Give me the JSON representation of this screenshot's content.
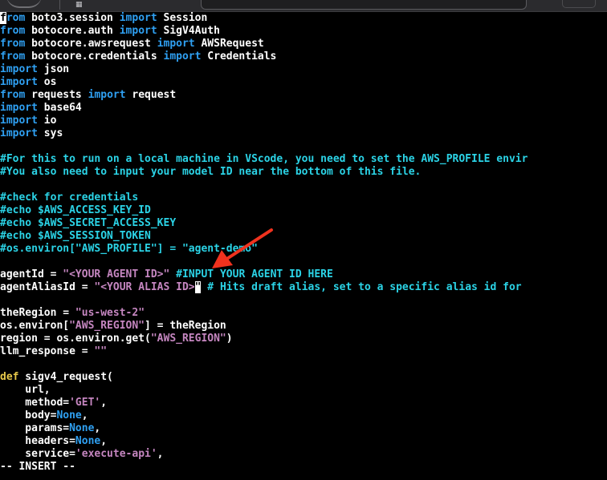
{
  "editor": {
    "mode_line": "-- INSERT --",
    "lines": [
      {
        "segs": [
          {
            "t": "f",
            "c": "cur"
          },
          {
            "t": "rom",
            "c": "kw"
          },
          {
            "t": " boto3.session ",
            "c": ""
          },
          {
            "t": "import",
            "c": "kw"
          },
          {
            "t": " Session",
            "c": ""
          }
        ]
      },
      {
        "segs": [
          {
            "t": "from",
            "c": "kw"
          },
          {
            "t": " botocore.auth ",
            "c": ""
          },
          {
            "t": "import",
            "c": "kw"
          },
          {
            "t": " SigV4Auth",
            "c": ""
          }
        ]
      },
      {
        "segs": [
          {
            "t": "from",
            "c": "kw"
          },
          {
            "t": " botocore.awsrequest ",
            "c": ""
          },
          {
            "t": "import",
            "c": "kw"
          },
          {
            "t": " AWSRequest",
            "c": ""
          }
        ]
      },
      {
        "segs": [
          {
            "t": "from",
            "c": "kw"
          },
          {
            "t": " botocore.credentials ",
            "c": ""
          },
          {
            "t": "import",
            "c": "kw"
          },
          {
            "t": " Credentials",
            "c": ""
          }
        ]
      },
      {
        "segs": [
          {
            "t": "import",
            "c": "kw"
          },
          {
            "t": " json",
            "c": ""
          }
        ]
      },
      {
        "segs": [
          {
            "t": "import",
            "c": "kw"
          },
          {
            "t": " os",
            "c": ""
          }
        ]
      },
      {
        "segs": [
          {
            "t": "from",
            "c": "kw"
          },
          {
            "t": " requests ",
            "c": ""
          },
          {
            "t": "import",
            "c": "kw"
          },
          {
            "t": " request",
            "c": ""
          }
        ]
      },
      {
        "segs": [
          {
            "t": "import",
            "c": "kw"
          },
          {
            "t": " base64",
            "c": ""
          }
        ]
      },
      {
        "segs": [
          {
            "t": "import",
            "c": "kw"
          },
          {
            "t": " io",
            "c": ""
          }
        ]
      },
      {
        "segs": [
          {
            "t": "import",
            "c": "kw"
          },
          {
            "t": " sys",
            "c": ""
          }
        ]
      },
      {
        "segs": []
      },
      {
        "segs": [
          {
            "t": "#For this to run on a local machine in VScode, you need to set the AWS_PROFILE envir",
            "c": "cm"
          }
        ]
      },
      {
        "segs": [
          {
            "t": "#You also need to input your model ID near the bottom of this file.",
            "c": "cm"
          }
        ]
      },
      {
        "segs": []
      },
      {
        "segs": [
          {
            "t": "#check for credentials",
            "c": "cm"
          }
        ]
      },
      {
        "segs": [
          {
            "t": "#echo $AWS_ACCESS_KEY_ID",
            "c": "cm"
          }
        ]
      },
      {
        "segs": [
          {
            "t": "#echo $AWS_SECRET_ACCESS_KEY",
            "c": "cm"
          }
        ]
      },
      {
        "segs": [
          {
            "t": "#echo $AWS_SESSION_TOKEN",
            "c": "cm"
          }
        ]
      },
      {
        "segs": [
          {
            "t": "#os.environ[\"AWS_PROFILE\"] = \"agent-demo\"",
            "c": "cm"
          }
        ]
      },
      {
        "segs": []
      },
      {
        "segs": [
          {
            "t": "agentId = ",
            "c": ""
          },
          {
            "t": "\"<YOUR AGENT ID>\"",
            "c": "str"
          },
          {
            "t": " ",
            "c": ""
          },
          {
            "t": "#INPUT YOUR AGENT ID HERE",
            "c": "cm"
          }
        ]
      },
      {
        "segs": [
          {
            "t": "agentAliasId = ",
            "c": ""
          },
          {
            "t": "\"<YOUR ALIAS ID>",
            "c": "str"
          },
          {
            "t": "\"",
            "c": "cur"
          },
          {
            "t": " ",
            "c": ""
          },
          {
            "t": "# Hits draft alias, set to a specific alias id for",
            "c": "cm"
          }
        ]
      },
      {
        "segs": []
      },
      {
        "segs": [
          {
            "t": "theRegion = ",
            "c": ""
          },
          {
            "t": "\"us-west-2\"",
            "c": "str"
          }
        ]
      },
      {
        "segs": [
          {
            "t": "os.environ[",
            "c": ""
          },
          {
            "t": "\"AWS_REGION\"",
            "c": "str"
          },
          {
            "t": "] = theRegion",
            "c": ""
          }
        ]
      },
      {
        "segs": [
          {
            "t": "region = os.environ.get(",
            "c": ""
          },
          {
            "t": "\"AWS_REGION\"",
            "c": "str"
          },
          {
            "t": ")",
            "c": ""
          }
        ]
      },
      {
        "segs": [
          {
            "t": "llm_response = ",
            "c": ""
          },
          {
            "t": "\"\"",
            "c": "str"
          }
        ]
      },
      {
        "segs": []
      },
      {
        "segs": [
          {
            "t": "def",
            "c": "def"
          },
          {
            "t": " sigv4_request(",
            "c": ""
          }
        ]
      },
      {
        "segs": [
          {
            "t": "    url,",
            "c": ""
          }
        ]
      },
      {
        "segs": [
          {
            "t": "    method=",
            "c": ""
          },
          {
            "t": "'GET'",
            "c": "str"
          },
          {
            "t": ",",
            "c": ""
          }
        ]
      },
      {
        "segs": [
          {
            "t": "    body=",
            "c": ""
          },
          {
            "t": "None",
            "c": "kw"
          },
          {
            "t": ",",
            "c": ""
          }
        ]
      },
      {
        "segs": [
          {
            "t": "    params=",
            "c": ""
          },
          {
            "t": "None",
            "c": "kw"
          },
          {
            "t": ",",
            "c": ""
          }
        ]
      },
      {
        "segs": [
          {
            "t": "    headers=",
            "c": ""
          },
          {
            "t": "None",
            "c": "kw"
          },
          {
            "t": ",",
            "c": ""
          }
        ]
      },
      {
        "segs": [
          {
            "t": "    service=",
            "c": ""
          },
          {
            "t": "'execute-api'",
            "c": "str"
          },
          {
            "t": ",",
            "c": ""
          }
        ]
      }
    ]
  },
  "topbar": {
    "grid_icon": "apps-grid-icon"
  },
  "annotation": {
    "arrow_color": "#f0321e"
  },
  "colors": {
    "keyword": "#2fa0f2",
    "string": "#c586c0",
    "comment": "#2bd3e6",
    "def": "#e6c84a",
    "text": "#ffffff",
    "background": "#000000"
  }
}
